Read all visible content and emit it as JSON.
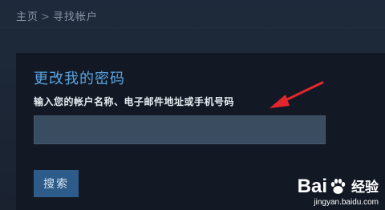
{
  "breadcrumb": {
    "home": "主页",
    "separator": ">",
    "current": "寻找帐户"
  },
  "form": {
    "title": "更改我的密码",
    "instruction": "输入您的帐户名称、电子邮件地址或手机号码",
    "input_value": "",
    "search_label": "搜索"
  },
  "watermark": {
    "brand_left": "Bai",
    "brand_right": "经验",
    "url": "jingyan.baidu.com"
  },
  "colors": {
    "title": "#5aa3e0",
    "button": "#2e5c8a",
    "input": "#3a4c60",
    "arrow": "#e3262d"
  }
}
